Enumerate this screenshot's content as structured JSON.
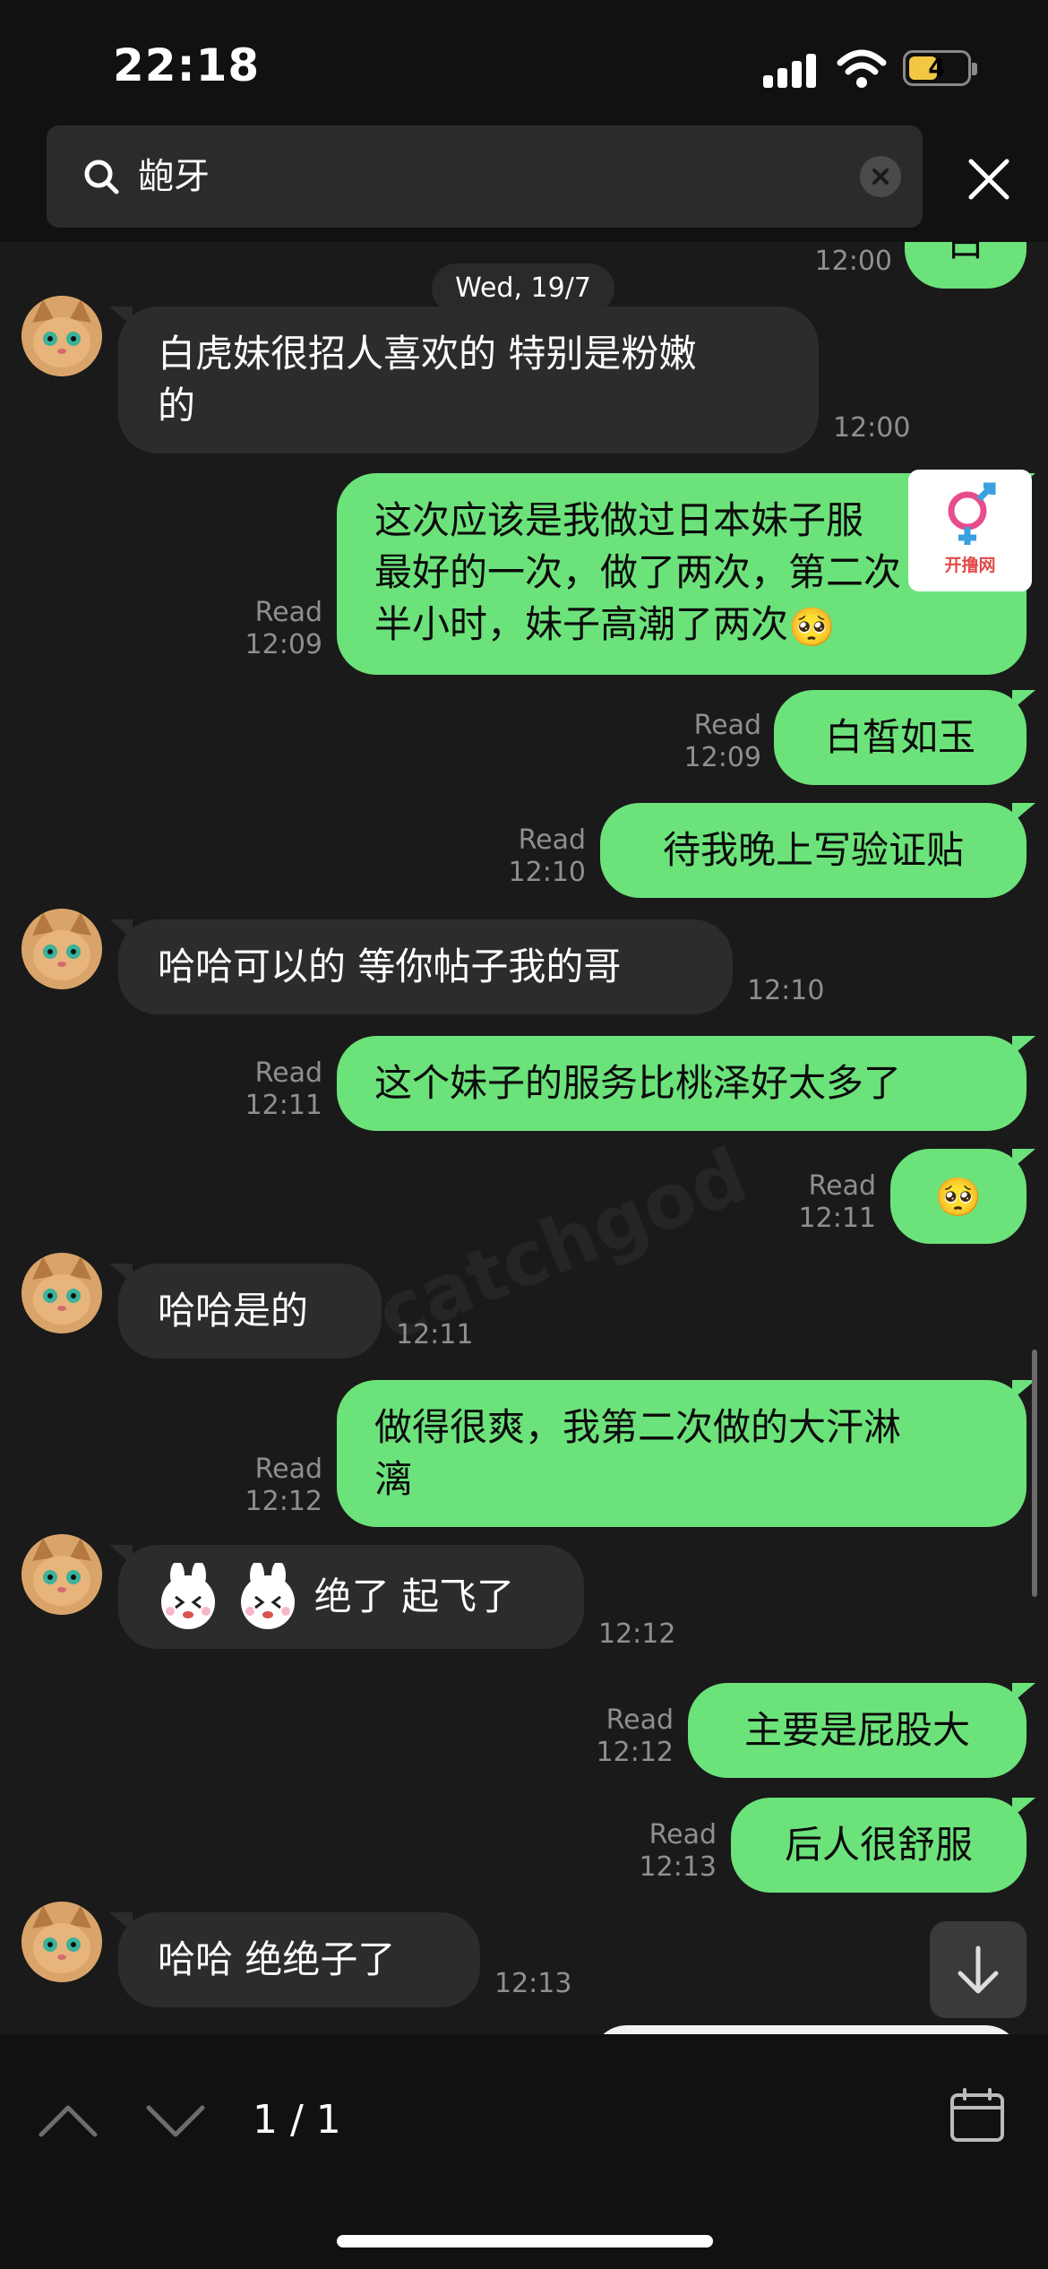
{
  "status_bar": {
    "time": "22:18",
    "battery_level": "4",
    "icons": [
      "signal-icon",
      "wifi-icon",
      "battery-icon"
    ]
  },
  "search": {
    "query": "龅牙",
    "icon": "search-icon",
    "clear_icon": "clear-icon",
    "close_icon": "close-icon"
  },
  "chat": {
    "date_label": "Wed, 19/7",
    "top_partial": {
      "time": "12:00",
      "text": "白"
    },
    "messages": [
      {
        "dir": "in",
        "text_lines": [
          "白虎妹很招人喜欢的 特别是粉嫩",
          "的"
        ],
        "time": "12:00"
      },
      {
        "dir": "out",
        "text_lines": [
          "这次应该是我做过日本妹子服",
          "最好的一次，做了两次，第二次",
          "半小时，妹子高潮了两次"
        ],
        "emoji": "🥺",
        "status": "Read",
        "time": "12:09"
      },
      {
        "dir": "out",
        "text": "白皙如玉",
        "status": "Read",
        "time": "12:09"
      },
      {
        "dir": "out",
        "text": "待我晚上写验证贴",
        "status": "Read",
        "time": "12:10"
      },
      {
        "dir": "in",
        "text": "哈哈可以的 等你帖子我的哥",
        "time": "12:10"
      },
      {
        "dir": "out",
        "text": "这个妹子的服务比桃泽好太多了",
        "status": "Read",
        "time": "12:11"
      },
      {
        "dir": "out",
        "emoji": "🥺",
        "status": "Read",
        "time": "12:11"
      },
      {
        "dir": "in",
        "text": "哈哈是的",
        "time": "12:11"
      },
      {
        "dir": "out",
        "text_lines": [
          "做得很爽，我第二次做的大汗淋",
          "漓"
        ],
        "status": "Read",
        "time": "12:12"
      },
      {
        "dir": "in",
        "stickers": [
          "bunny-sticker",
          "bunny-sticker"
        ],
        "text": "绝了  起飞了",
        "time": "12:12"
      },
      {
        "dir": "out",
        "text": "主要是屁股大",
        "status": "Read",
        "time": "12:12"
      },
      {
        "dir": "out",
        "text": "后人很舒服",
        "status": "Read",
        "time": "12:13"
      },
      {
        "dir": "in",
        "text": "哈哈 绝绝子了",
        "time": "12:13"
      }
    ],
    "badge_label": "开撸网",
    "watermark": "catchgod"
  },
  "bottom_bar": {
    "counter": "1 / 1",
    "icons": [
      "chevron-up-icon",
      "chevron-down-icon",
      "calendar-icon"
    ]
  },
  "colors": {
    "outgoing_bubble": "#6ce27b",
    "incoming_bubble": "#2c2c2c",
    "background": "#1a1a1a",
    "bar": "#111111",
    "meta_text": "#8f8f8f"
  }
}
